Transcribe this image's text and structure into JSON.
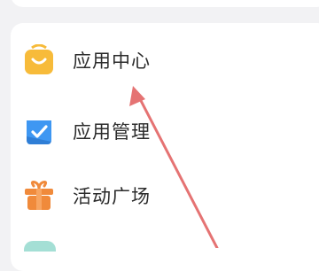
{
  "menu": {
    "items": [
      {
        "label": "应用中心",
        "icon": "shopping-bag-icon",
        "color": "#F7BB3A"
      },
      {
        "label": "应用管理",
        "icon": "check-card-icon",
        "color": "#3E97F2"
      },
      {
        "label": "活动广场",
        "icon": "gift-icon",
        "color": "#F08A3B"
      }
    ]
  },
  "annotation": {
    "arrow_color": "#E57373"
  }
}
